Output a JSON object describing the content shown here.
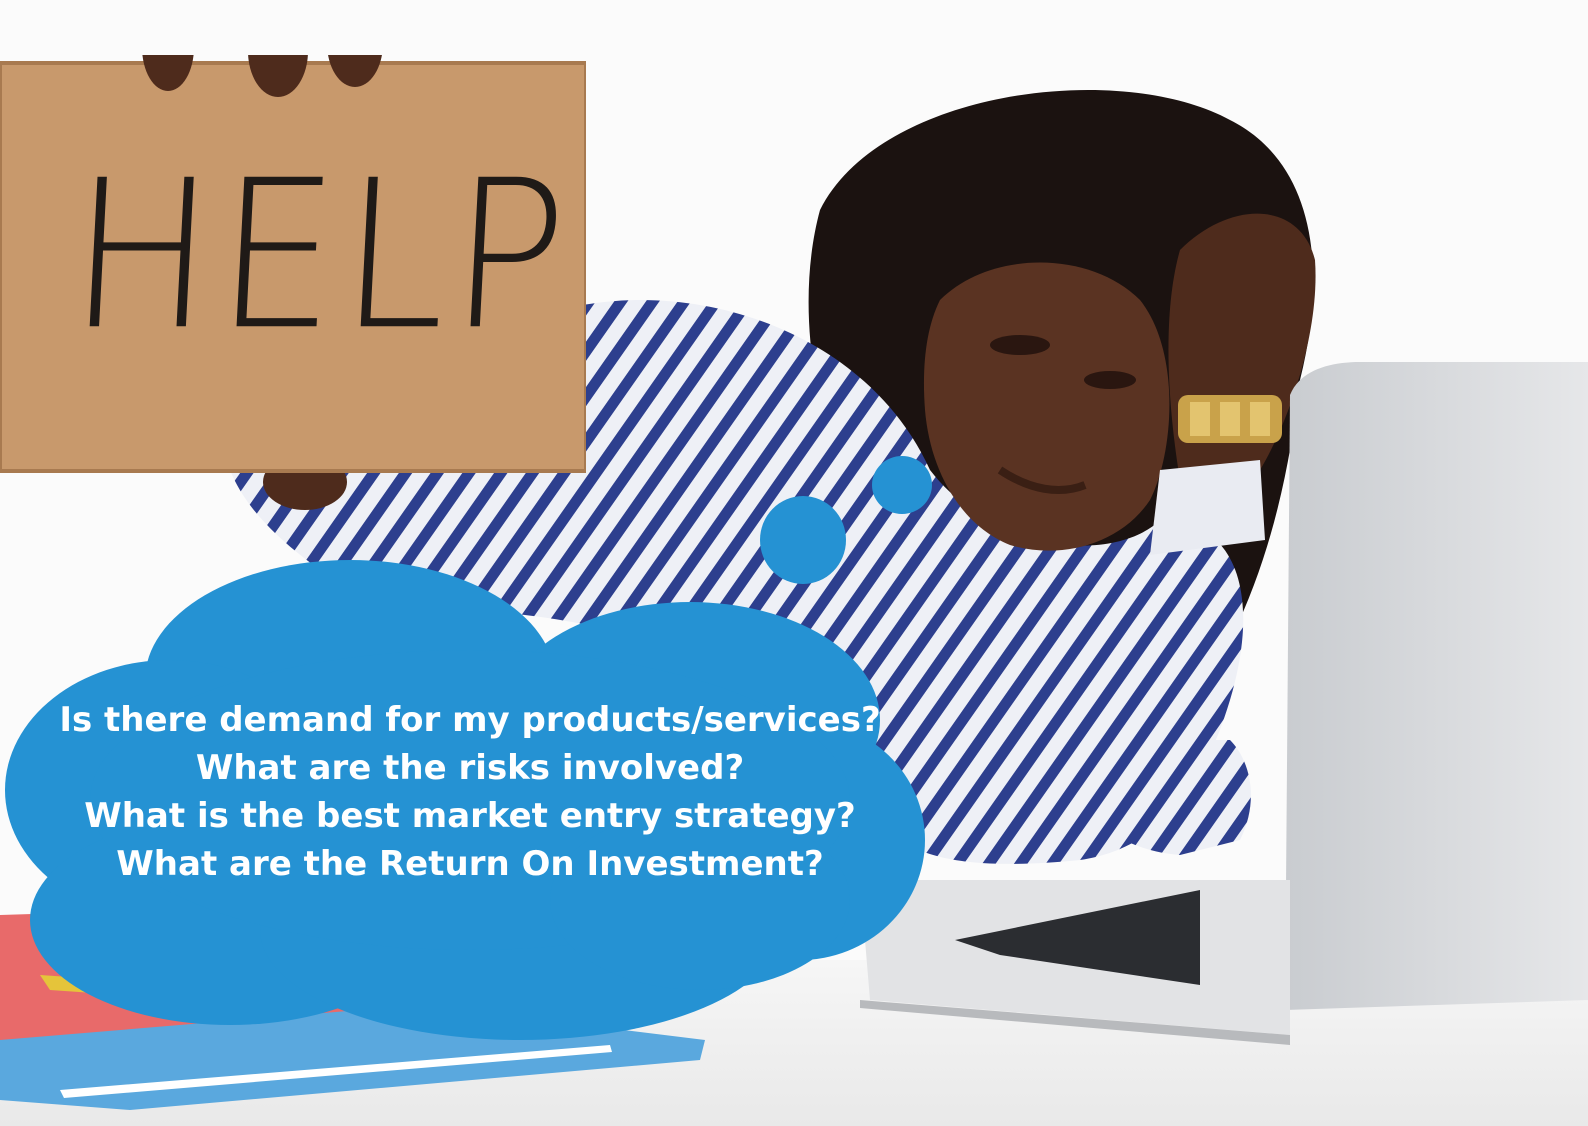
{
  "sign": {
    "text": "HELP"
  },
  "thought_bubble": {
    "lines": [
      "Is there demand for my products/services?",
      "What are the risks involved?",
      "What is the best market entry strategy?",
      "What are the Return On Investment?"
    ]
  },
  "colors": {
    "bubble": "#2592d3",
    "cardboard": "#c8996c",
    "shirt_stripe": "#2d3f8e",
    "laptop": "#d8dadc",
    "background": "#fbfbfb"
  }
}
